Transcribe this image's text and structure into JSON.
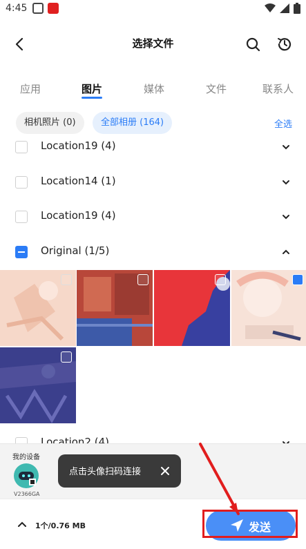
{
  "status_bar": {
    "time": "4:45"
  },
  "header": {
    "title": "选择文件"
  },
  "tabs": [
    {
      "label": "应用",
      "active": false
    },
    {
      "label": "图片",
      "active": true
    },
    {
      "label": "媒体",
      "active": false
    },
    {
      "label": "文件",
      "active": false
    },
    {
      "label": "联系人",
      "active": false
    }
  ],
  "filters": {
    "camera_label": "相机照片 (0)",
    "all_albums_label": "全部相册 (164)",
    "select_all": "全选"
  },
  "albums": [
    {
      "label": "Location19 (4)",
      "checked": false,
      "expanded": false
    },
    {
      "label": "Location14 (1)",
      "checked": false,
      "expanded": false
    },
    {
      "label": "Location19 (4)",
      "checked": false,
      "expanded": false
    },
    {
      "label": "Original (1/5)",
      "checked": true,
      "expanded": true
    },
    {
      "label": "Location2 (4)",
      "checked": false,
      "expanded": false
    }
  ],
  "thumbnails": [
    {
      "checked": false
    },
    {
      "checked": false
    },
    {
      "checked": false
    },
    {
      "checked": true
    },
    {
      "checked": false
    }
  ],
  "device_panel": {
    "header": "我的设备",
    "device_name": "V2366GA",
    "tooltip": "点击头像扫码连接"
  },
  "bottom_bar": {
    "selection_info": "1个/0.76 MB",
    "send_label": "发送"
  },
  "colors": {
    "accent": "#2b7cf6",
    "annotation": "#e11d1d"
  }
}
